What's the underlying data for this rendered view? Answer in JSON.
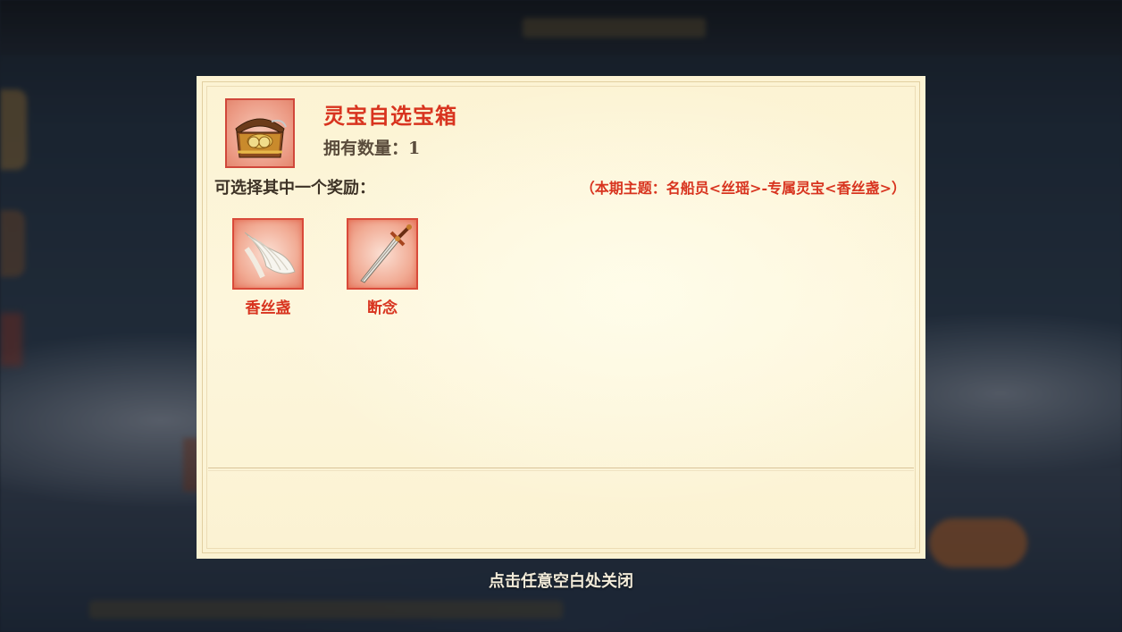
{
  "dialog": {
    "item_title": "灵宝自选宝箱",
    "owned_label": "拥有数量：",
    "owned_count": "1",
    "choose_label": "可选择其中一个奖励：",
    "theme_text": "（本期主题：名船员<丝瑶>-专属灵宝<香丝盏>）",
    "item_icon": "treasure-chest-icon",
    "rewards": [
      {
        "name": "香丝盏",
        "icon": "white-silk-fan-icon"
      },
      {
        "name": "断念",
        "icon": "sword-icon"
      }
    ]
  },
  "close_hint": "点击任意空白处关闭",
  "colors": {
    "accent_red": "#d8341f",
    "panel_bg": "#fcf3d3",
    "text_dark": "#3d3226"
  }
}
